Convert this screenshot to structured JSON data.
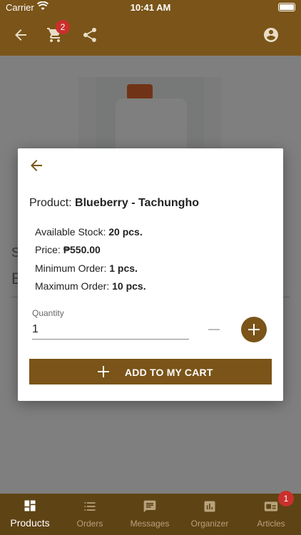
{
  "status_bar": {
    "carrier": "Carrier",
    "time": "10:41 AM"
  },
  "app_bar": {
    "cart_badge": "2",
    "icons": [
      "back-arrow-icon",
      "cart-icon",
      "share-icon",
      "account-icon"
    ]
  },
  "background_page": {
    "line1": "S",
    "line2": "B"
  },
  "dialog": {
    "product_prefix": "Product:",
    "product_name": "Blueberry - Tachungho",
    "available_stock_label": "Available Stock:",
    "available_stock_value": "20 pcs.",
    "price_label": "Price:",
    "price_value": "₱550.00",
    "min_order_label": "Minimum Order:",
    "min_order_value": "1 pcs.",
    "max_order_label": "Maximum Order:",
    "max_order_value": "10 pcs.",
    "quantity_label": "Quantity",
    "quantity_value": "1",
    "add_button_label": "ADD TO MY CART"
  },
  "bottom_nav": {
    "items": [
      {
        "label": "Products",
        "icon": "products-icon"
      },
      {
        "label": "Orders",
        "icon": "orders-icon"
      },
      {
        "label": "Messages",
        "icon": "messages-icon"
      },
      {
        "label": "Organizer",
        "icon": "organizer-icon"
      },
      {
        "label": "Articles",
        "icon": "articles-icon"
      }
    ],
    "articles_badge": "1"
  },
  "colors": {
    "primary": "#7a5418",
    "nav_bg": "#5e4314",
    "badge": "#c9302c"
  }
}
